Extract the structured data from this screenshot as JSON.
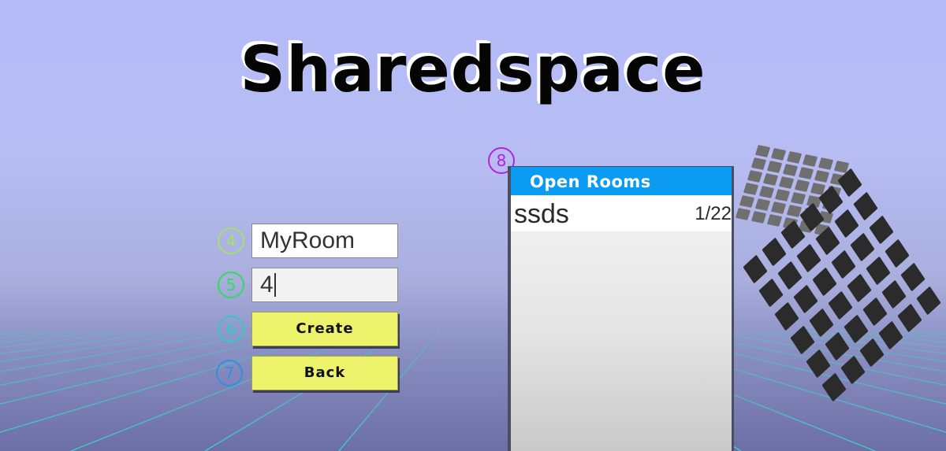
{
  "title": "Sharedspace",
  "form": {
    "room_name": {
      "callout": "4",
      "value": "MyRoom"
    },
    "max_players": {
      "callout": "5",
      "value": "4"
    },
    "create": {
      "callout": "6",
      "label": "Create"
    },
    "back": {
      "callout": "7",
      "label": "Back"
    }
  },
  "rooms_panel": {
    "callout": "8",
    "header": "Open Rooms",
    "rooms": [
      {
        "name": "ssds",
        "count": "1/22"
      }
    ]
  },
  "colors": {
    "button": "#ecf26a",
    "header": "#0c9bf2",
    "grid": "#3fd1c0",
    "callout_4": "#9fe36a",
    "callout_5": "#2fdc5c",
    "callout_6": "#32c9c4",
    "callout_7": "#2f8fe0",
    "callout_8": "#b423d8"
  }
}
